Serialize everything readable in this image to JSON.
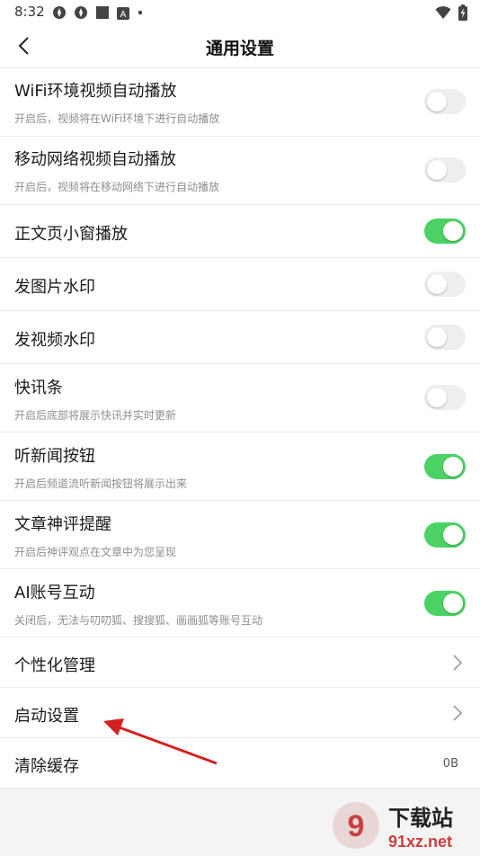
{
  "status": {
    "time": "8:32",
    "icons": [
      "app-icon-1",
      "app-icon-2",
      "square-icon",
      "a-icon",
      "dot-icon"
    ],
    "wifi": "wifi-icon",
    "battery": "battery-charging-icon"
  },
  "header": {
    "title": "通用设置"
  },
  "settings": [
    {
      "label": "WiFi环境视频自动播放",
      "sub": "开启后，视频将在WiFi环境下进行自动播放",
      "type": "toggle",
      "on": false
    },
    {
      "label": "移动网络视频自动播放",
      "sub": "开启后，视频将在移动网络下进行自动播放",
      "type": "toggle",
      "on": false
    },
    {
      "label": "正文页小窗播放",
      "type": "toggle",
      "on": true
    },
    {
      "label": "发图片水印",
      "type": "toggle",
      "on": false
    },
    {
      "label": "发视频水印",
      "type": "toggle",
      "on": false
    },
    {
      "label": "快讯条",
      "sub": "开启后底部将展示快讯并实时更新",
      "type": "toggle",
      "on": false
    },
    {
      "label": "听新闻按钮",
      "sub": "开启后频道流听新闻按钮将展示出来",
      "type": "toggle",
      "on": true
    },
    {
      "label": "文章神评提醒",
      "sub": "开启后神评观点在文章中为您呈现",
      "type": "toggle",
      "on": true
    },
    {
      "label": "AI账号互动",
      "sub": "关闭后，无法与叨叨狐、搜搜狐、画画狐等账号互动",
      "type": "toggle",
      "on": true
    },
    {
      "label": "个性化管理",
      "type": "link"
    },
    {
      "label": "启动设置",
      "type": "link"
    },
    {
      "label": "清除缓存",
      "type": "value",
      "value": "0B"
    }
  ],
  "watermark": {
    "big": "下载站",
    "small": "91xz.net",
    "logo": "9"
  },
  "colors": {
    "toggle_on": "#4cd264",
    "toggle_off": "#eeeeee",
    "arrow": "#d42020"
  }
}
